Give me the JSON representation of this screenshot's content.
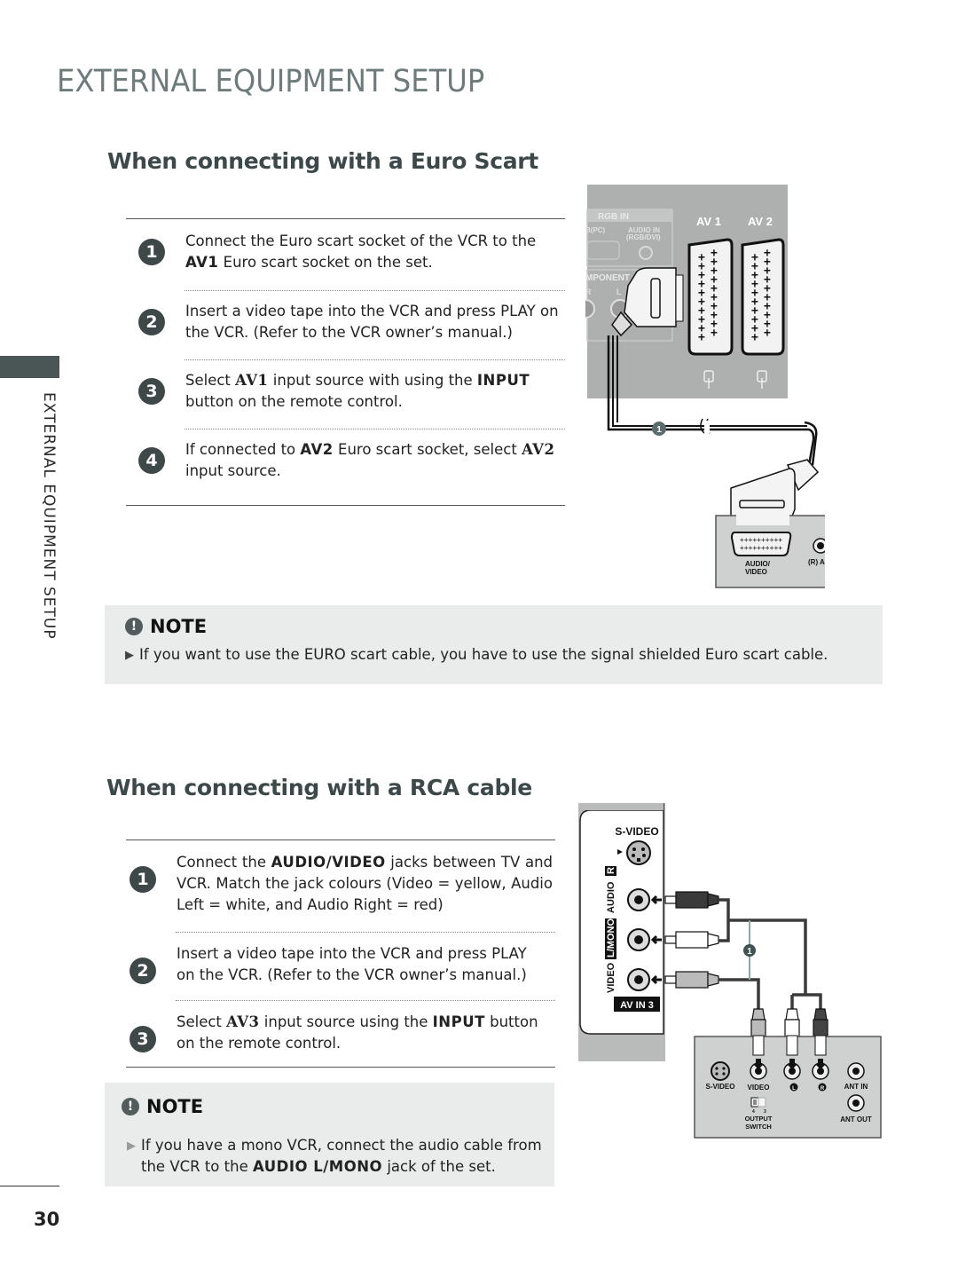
{
  "page": {
    "title": "EXTERNAL EQUIPMENT SETUP",
    "side_label": "EXTERNAL EQUIPMENT SETUP",
    "page_number": "30"
  },
  "scart_section": {
    "title": "When connecting with a Euro Scart",
    "steps": [
      {
        "number": "1",
        "parts": [
          "Connect the Euro scart socket of the VCR to the ",
          "AV1",
          " Euro scart socket on the set."
        ]
      },
      {
        "number": "2",
        "parts": [
          "Insert a video tape into the VCR and press PLAY on the VCR. (Refer to the VCR owner’s manual.)"
        ]
      },
      {
        "number": "3",
        "parts": [
          "Select ",
          "AV1",
          " input source with using the ",
          "INPUT",
          " button on the remote control."
        ]
      },
      {
        "number": "4",
        "parts": [
          "If connected to ",
          "AV2",
          " Euro scart socket, select ",
          "AV2",
          " input source."
        ]
      }
    ],
    "note": {
      "heading": "NOTE",
      "icon": "exclamation-icon",
      "text": "If you want to use the EURO scart cable, you have to use the signal shielded Euro scart cable."
    },
    "diagram": {
      "tv_labels": {
        "rgb_in": "RGB IN",
        "rgb_pc": "B(PC)",
        "audio_in": "AUDIO IN",
        "audio_in_sub": "(RGB/DVI)",
        "component": "MPONENT",
        "comp_r": "R",
        "comp_l": "L",
        "av1": "AV 1",
        "av2": "AV 2"
      },
      "cable_marker": "1",
      "vcr_labels": {
        "av_line1": "AUDIO/",
        "av_line2": "VIDEO",
        "audio": "(R) AUDIO (L)"
      }
    }
  },
  "rca_section": {
    "title": "When connecting with a RCA cable",
    "steps": [
      {
        "number": "1",
        "parts": [
          "Connect the ",
          "AUDIO/VIDEO",
          " jacks between TV and VCR. Match the jack colours (Video = yellow, Audio Left = white, and Audio Right = red)"
        ]
      },
      {
        "number": "2",
        "parts": [
          "Insert a video tape into the VCR and press PLAY on the VCR. (Refer to the VCR owner’s manual.)"
        ]
      },
      {
        "number": "3",
        "parts": [
          "Select ",
          "AV3",
          " input source using the ",
          "INPUT",
          " button on the remote control."
        ]
      }
    ],
    "note": {
      "heading": "NOTE",
      "icon": "exclamation-icon",
      "parts": [
        "If you have a mono VCR, connect the audio cable from the VCR to the ",
        "AUDIO L/MONO",
        " jack of the set."
      ]
    },
    "diagram": {
      "tv_labels": {
        "svideo": "S-VIDEO",
        "video": "VIDEO",
        "lmono": "L/MONO",
        "audio": "AUDIO",
        "r": "R",
        "av_in": "AV IN 3"
      },
      "cable_marker": "1",
      "vcr_labels": {
        "svideo": "S-VIDEO",
        "video": "VIDEO",
        "l": "L",
        "r": "R",
        "ant_in": "ANT IN",
        "ant_out": "ANT OUT",
        "switch_4": "4",
        "switch_3": "3",
        "output1": "OUTPUT",
        "output2": "SWITCH"
      }
    }
  }
}
